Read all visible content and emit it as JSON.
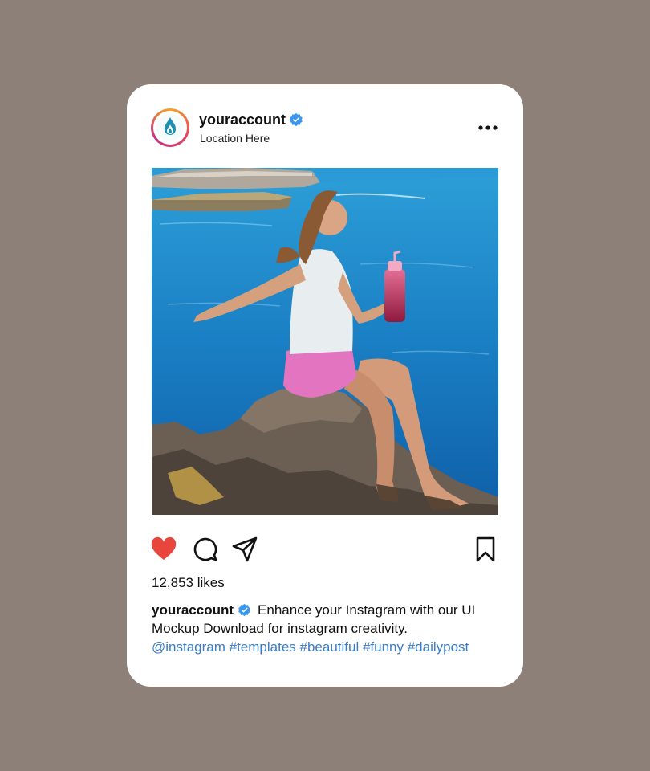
{
  "post": {
    "username": "youraccount",
    "location": "Location Here",
    "likes": "12,853 likes",
    "caption_text": "Enhance your Instagram with our UI Mockup Download for instagram creativity.",
    "tags": "@instagram #templates #beautiful #funny #dailypost",
    "liked": true
  },
  "icons": {
    "avatar_logo": "water-drop-logo",
    "verified": "verified-badge-icon",
    "more": "more-options-icon",
    "like": "heart-icon",
    "comment": "comment-icon",
    "share": "share-icon",
    "save": "bookmark-icon"
  },
  "colors": {
    "background": "#8c8079",
    "card": "#ffffff",
    "heart": "#e8453c",
    "verified": "#3897f0",
    "hashtag": "#3b7cc4"
  }
}
